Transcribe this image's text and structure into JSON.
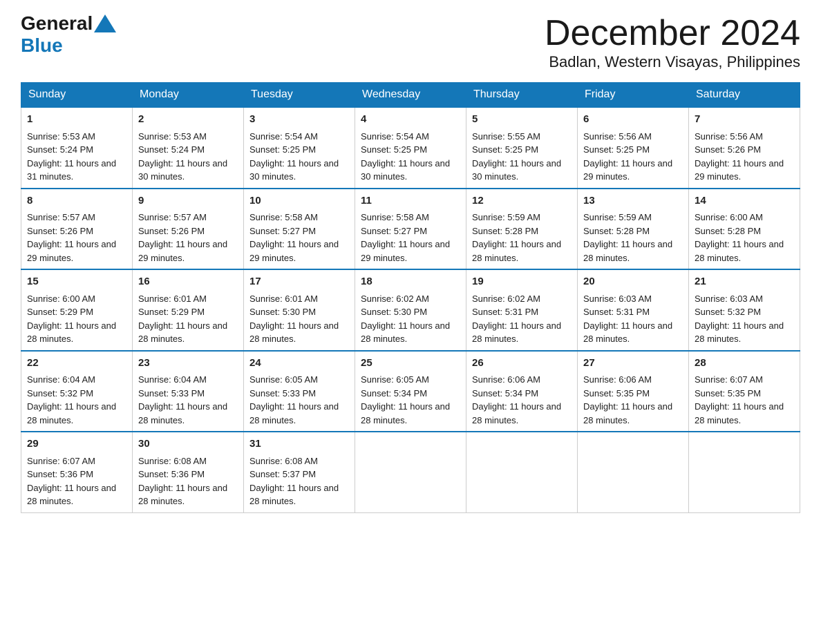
{
  "header": {
    "logo_general": "General",
    "logo_blue": "Blue",
    "month_title": "December 2024",
    "location": "Badlan, Western Visayas, Philippines"
  },
  "weekdays": [
    "Sunday",
    "Monday",
    "Tuesday",
    "Wednesday",
    "Thursday",
    "Friday",
    "Saturday"
  ],
  "weeks": [
    [
      {
        "day": "1",
        "sunrise": "5:53 AM",
        "sunset": "5:24 PM",
        "daylight": "11 hours and 31 minutes."
      },
      {
        "day": "2",
        "sunrise": "5:53 AM",
        "sunset": "5:24 PM",
        "daylight": "11 hours and 30 minutes."
      },
      {
        "day": "3",
        "sunrise": "5:54 AM",
        "sunset": "5:25 PM",
        "daylight": "11 hours and 30 minutes."
      },
      {
        "day": "4",
        "sunrise": "5:54 AM",
        "sunset": "5:25 PM",
        "daylight": "11 hours and 30 minutes."
      },
      {
        "day": "5",
        "sunrise": "5:55 AM",
        "sunset": "5:25 PM",
        "daylight": "11 hours and 30 minutes."
      },
      {
        "day": "6",
        "sunrise": "5:56 AM",
        "sunset": "5:25 PM",
        "daylight": "11 hours and 29 minutes."
      },
      {
        "day": "7",
        "sunrise": "5:56 AM",
        "sunset": "5:26 PM",
        "daylight": "11 hours and 29 minutes."
      }
    ],
    [
      {
        "day": "8",
        "sunrise": "5:57 AM",
        "sunset": "5:26 PM",
        "daylight": "11 hours and 29 minutes."
      },
      {
        "day": "9",
        "sunrise": "5:57 AM",
        "sunset": "5:26 PM",
        "daylight": "11 hours and 29 minutes."
      },
      {
        "day": "10",
        "sunrise": "5:58 AM",
        "sunset": "5:27 PM",
        "daylight": "11 hours and 29 minutes."
      },
      {
        "day": "11",
        "sunrise": "5:58 AM",
        "sunset": "5:27 PM",
        "daylight": "11 hours and 29 minutes."
      },
      {
        "day": "12",
        "sunrise": "5:59 AM",
        "sunset": "5:28 PM",
        "daylight": "11 hours and 28 minutes."
      },
      {
        "day": "13",
        "sunrise": "5:59 AM",
        "sunset": "5:28 PM",
        "daylight": "11 hours and 28 minutes."
      },
      {
        "day": "14",
        "sunrise": "6:00 AM",
        "sunset": "5:28 PM",
        "daylight": "11 hours and 28 minutes."
      }
    ],
    [
      {
        "day": "15",
        "sunrise": "6:00 AM",
        "sunset": "5:29 PM",
        "daylight": "11 hours and 28 minutes."
      },
      {
        "day": "16",
        "sunrise": "6:01 AM",
        "sunset": "5:29 PM",
        "daylight": "11 hours and 28 minutes."
      },
      {
        "day": "17",
        "sunrise": "6:01 AM",
        "sunset": "5:30 PM",
        "daylight": "11 hours and 28 minutes."
      },
      {
        "day": "18",
        "sunrise": "6:02 AM",
        "sunset": "5:30 PM",
        "daylight": "11 hours and 28 minutes."
      },
      {
        "day": "19",
        "sunrise": "6:02 AM",
        "sunset": "5:31 PM",
        "daylight": "11 hours and 28 minutes."
      },
      {
        "day": "20",
        "sunrise": "6:03 AM",
        "sunset": "5:31 PM",
        "daylight": "11 hours and 28 minutes."
      },
      {
        "day": "21",
        "sunrise": "6:03 AM",
        "sunset": "5:32 PM",
        "daylight": "11 hours and 28 minutes."
      }
    ],
    [
      {
        "day": "22",
        "sunrise": "6:04 AM",
        "sunset": "5:32 PM",
        "daylight": "11 hours and 28 minutes."
      },
      {
        "day": "23",
        "sunrise": "6:04 AM",
        "sunset": "5:33 PM",
        "daylight": "11 hours and 28 minutes."
      },
      {
        "day": "24",
        "sunrise": "6:05 AM",
        "sunset": "5:33 PM",
        "daylight": "11 hours and 28 minutes."
      },
      {
        "day": "25",
        "sunrise": "6:05 AM",
        "sunset": "5:34 PM",
        "daylight": "11 hours and 28 minutes."
      },
      {
        "day": "26",
        "sunrise": "6:06 AM",
        "sunset": "5:34 PM",
        "daylight": "11 hours and 28 minutes."
      },
      {
        "day": "27",
        "sunrise": "6:06 AM",
        "sunset": "5:35 PM",
        "daylight": "11 hours and 28 minutes."
      },
      {
        "day": "28",
        "sunrise": "6:07 AM",
        "sunset": "5:35 PM",
        "daylight": "11 hours and 28 minutes."
      }
    ],
    [
      {
        "day": "29",
        "sunrise": "6:07 AM",
        "sunset": "5:36 PM",
        "daylight": "11 hours and 28 minutes."
      },
      {
        "day": "30",
        "sunrise": "6:08 AM",
        "sunset": "5:36 PM",
        "daylight": "11 hours and 28 minutes."
      },
      {
        "day": "31",
        "sunrise": "6:08 AM",
        "sunset": "5:37 PM",
        "daylight": "11 hours and 28 minutes."
      },
      null,
      null,
      null,
      null
    ]
  ]
}
